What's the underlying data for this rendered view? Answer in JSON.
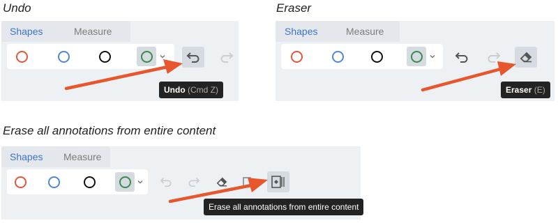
{
  "sections": {
    "undo": {
      "caption": "Undo",
      "tabs": [
        "Shapes",
        "Measure"
      ],
      "tooltip_label": "Undo",
      "tooltip_shortcut": "(Cmd Z)"
    },
    "eraser": {
      "caption": "Eraser",
      "tabs": [
        "Shapes",
        "Measure"
      ],
      "tooltip_label": "Eraser",
      "tooltip_shortcut": "(E)"
    },
    "erase_all": {
      "caption": "Erase all annotations from entire content",
      "tabs": [
        "Shapes",
        "Measure"
      ],
      "tooltip_label": "Erase all annotations from entire content"
    }
  },
  "colors": {
    "red_ring": "#e0573a",
    "blue_ring": "#4f86d9",
    "black_ring": "#111111",
    "green_ring": "#3a8b4e",
    "arrow": "#e8562e",
    "active_tab": "#3d73c4"
  },
  "icons": [
    "red-circle-tool-icon",
    "blue-circle-tool-icon",
    "black-circle-tool-icon",
    "green-circle-tool-icon",
    "chevron-down-icon",
    "undo-icon",
    "redo-icon",
    "eraser-icon",
    "erase-all-icon",
    "pointer-arrow-icon"
  ]
}
